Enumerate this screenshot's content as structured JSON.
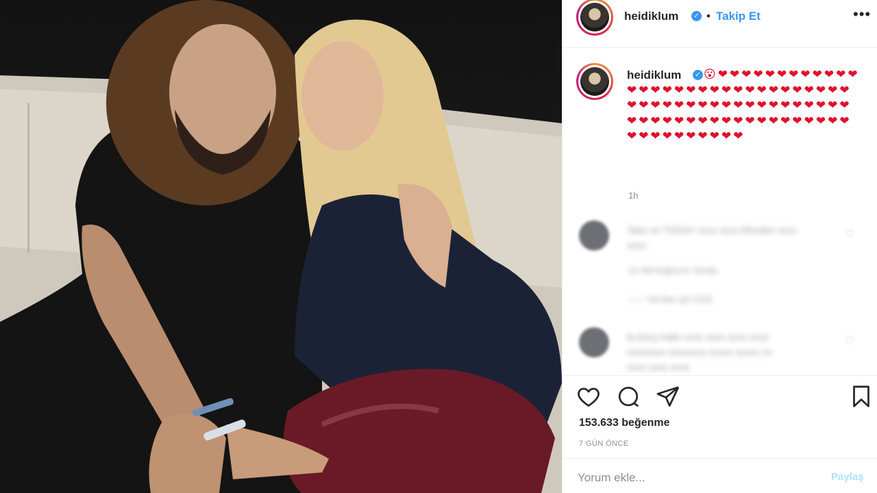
{
  "post": {
    "username": "heidiklum",
    "verified_icon": "verified-badge-icon",
    "follow_label": "Takip Et",
    "more_icon": "more-options-icon",
    "caption_text": "😮❤❤❤❤❤❤❤❤❤❤❤❤❤❤❤❤❤❤❤❤❤❤❤❤❤❤❤❤❤❤❤❤❤❤❤❤❤❤❤❤❤❤❤❤❤❤❤❤❤❤❤❤❤❤❤❤❤❤❤❤❤❤❤❤❤❤❤❤❤❤❤❤❤❤❤❤❤❤❤",
    "time_ago": "1h",
    "likes": "153.633 beğenme",
    "date": "7 GÜN ÖNCE",
    "comment_placeholder": "Yorum ekle...",
    "post_button": "Paylaş"
  },
  "comments": [
    {
      "text_line1": "Take on TODAY xxxx xxxx Rhoden xxxx",
      "text_line2": "xxxx",
      "meta": "1h    289 beğenme    Yanıtla",
      "replies": "——    Yanıtları gör (183)"
    },
    {
      "text_line1": "tk.kwzy hallo xxxx xxxx xxxx xxxx",
      "text_line2": "xxxxxxxx xxxxxxxx xxxxx xxxxx xx",
      "text_line3": "xxxx xxxx xxxx"
    }
  ],
  "icons": [
    "heart-icon",
    "comment-icon",
    "share-icon",
    "bookmark-icon"
  ],
  "colors": {
    "accent": "#3897f0",
    "heart": "#e0102b",
    "text": "#262626",
    "muted": "#8e8e8e"
  }
}
